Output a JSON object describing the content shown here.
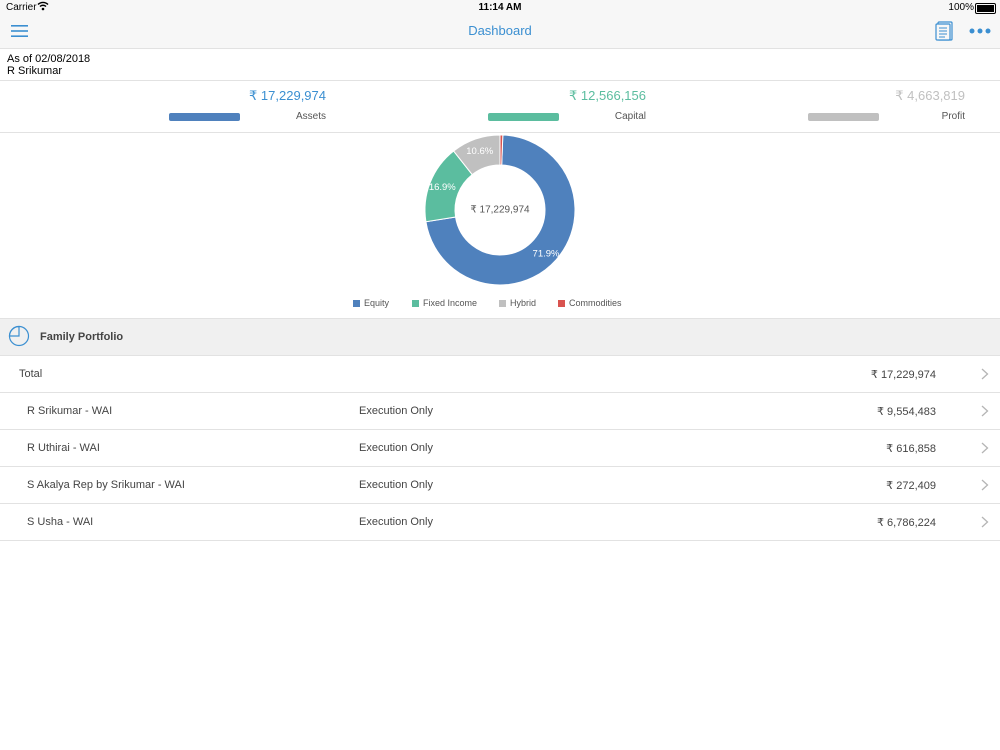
{
  "status_bar": {
    "carrier": "Carrier",
    "time": "11:14 AM",
    "battery": "100%"
  },
  "nav": {
    "title": "Dashboard",
    "left_icon": "hamburger-menu-icon",
    "right_icons": [
      "report-document-icon",
      "more-dots-icon"
    ]
  },
  "header": {
    "as_of": "As of 02/08/2018",
    "client_name": "R Srikumar"
  },
  "summary": [
    {
      "value": "₹ 17,229,974",
      "label": "Assets",
      "color": "#4f81bd"
    },
    {
      "value": "₹ 12,566,156",
      "label": "Capital",
      "color": "#5bbd9f"
    },
    {
      "value": "₹ 4,663,819",
      "label": "Profit",
      "color": "#c0c0c0"
    }
  ],
  "chart_data": {
    "type": "pie",
    "center_label": "₹ 17,229,974",
    "slices": [
      {
        "label": "Equity",
        "value": 71.9,
        "display": "71.9%",
        "color": "#4f81bd"
      },
      {
        "label": "Fixed Income",
        "value": 16.9,
        "display": "16.9%",
        "color": "#5bbd9f"
      },
      {
        "label": "Hybrid",
        "value": 10.6,
        "display": "10.6%",
        "color": "#c0c0c0"
      },
      {
        "label": "Commodities",
        "value": 0.6,
        "display": "",
        "color": "#d9534f"
      }
    ],
    "legend": [
      "Equity",
      "Fixed Income",
      "Hybrid",
      "Commodities"
    ],
    "legend_position": "bottom"
  },
  "family_portfolio": {
    "title": "Family Portfolio",
    "rows": [
      {
        "name": "Total",
        "type": "",
        "amount": "₹ 17,229,974"
      },
      {
        "name": "R Srikumar - WAI",
        "type": "Execution Only",
        "amount": "₹ 9,554,483"
      },
      {
        "name": "R Uthirai - WAI",
        "type": "Execution Only",
        "amount": "₹ 616,858"
      },
      {
        "name": "S Akalya Rep by Srikumar - WAI",
        "type": "Execution Only",
        "amount": "₹ 272,409"
      },
      {
        "name": "S Usha - WAI",
        "type": "Execution Only",
        "amount": "₹ 6,786,224"
      }
    ]
  }
}
